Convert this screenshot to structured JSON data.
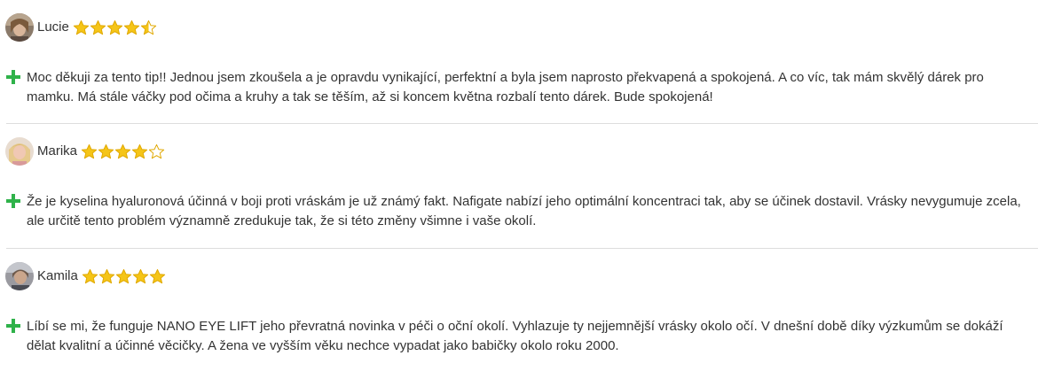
{
  "reviews": [
    {
      "name": "Lucie",
      "rating": 4.5,
      "text": "Moc děkuji za tento tip!! Jednou jsem zkoušela a je opravdu vynikající, perfektní a byla jsem naprosto překvapená a spokojená. A co víc, tak mám skvělý dárek pro mamku. Má stále váčky pod očima a kruhy a tak se těším, až si koncem května rozbalí tento dárek. Bude spokojená!"
    },
    {
      "name": "Marika",
      "rating": 4,
      "text": "Že je kyselina hyaluronová účinná v boji proti vráskám je už známý fakt. Nafigate nabízí jeho optimální koncentraci tak, aby se účinek dostavil. Vrásky nevygumuje zcela, ale určitě tento problém významně zredukuje tak, že si této změny všimne i vaše okolí."
    },
    {
      "name": "Kamila",
      "rating": 5,
      "text": "Líbí se mi, že funguje NANO EYE LIFT jeho převratná novinka v péči o oční okolí. Vyhlazuje ty nejjemnější vrásky okolo očí. V dnešní době díky výzkumům se dokáží dělat kvalitní a účinné věcičky. A žena ve vyšším věku nechce vypadat jako babičky okolo roku 2000."
    }
  ],
  "colors": {
    "star": "#f5c518",
    "star_outline": "#e0a800",
    "plus": "#2fb24a",
    "divider": "#dddddd",
    "text": "#333333"
  },
  "icons": {
    "plus": "plus-icon",
    "star": "star-icon"
  }
}
